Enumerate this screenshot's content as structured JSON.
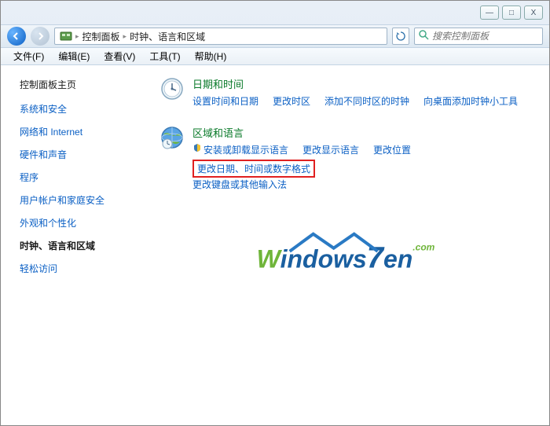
{
  "window": {
    "minimize": "—",
    "maximize": "□",
    "close": "X"
  },
  "breadcrumb": {
    "control_panel": "控制面板",
    "current": "时钟、语言和区域"
  },
  "search": {
    "placeholder": "搜索控制面板"
  },
  "menubar": {
    "file": "文件(F)",
    "edit": "编辑(E)",
    "view": "查看(V)",
    "tools": "工具(T)",
    "help": "帮助(H)"
  },
  "sidebar": {
    "heading": "控制面板主页",
    "items": [
      "系统和安全",
      "网络和 Internet",
      "硬件和声音",
      "程序",
      "用户帐户和家庭安全",
      "外观和个性化"
    ],
    "current": "时钟、语言和区域",
    "after": [
      "轻松访问"
    ]
  },
  "content": {
    "section1": {
      "title": "日期和时间",
      "links": [
        "设置时间和日期",
        "更改时区",
        "添加不同时区的时钟",
        "向桌面添加时钟小工具"
      ]
    },
    "section2": {
      "title": "区域和语言",
      "links_row1": [
        "安装或卸载显示语言",
        "更改显示语言",
        "更改位置"
      ],
      "highlighted": "更改日期、时间或数字格式",
      "links_row2": [
        "更改键盘或其他输入法"
      ]
    }
  },
  "watermark": {
    "text_w": "W",
    "text_indows": "indows",
    "text_seven": "7",
    "text_en": "en",
    "text_com": ".com"
  }
}
